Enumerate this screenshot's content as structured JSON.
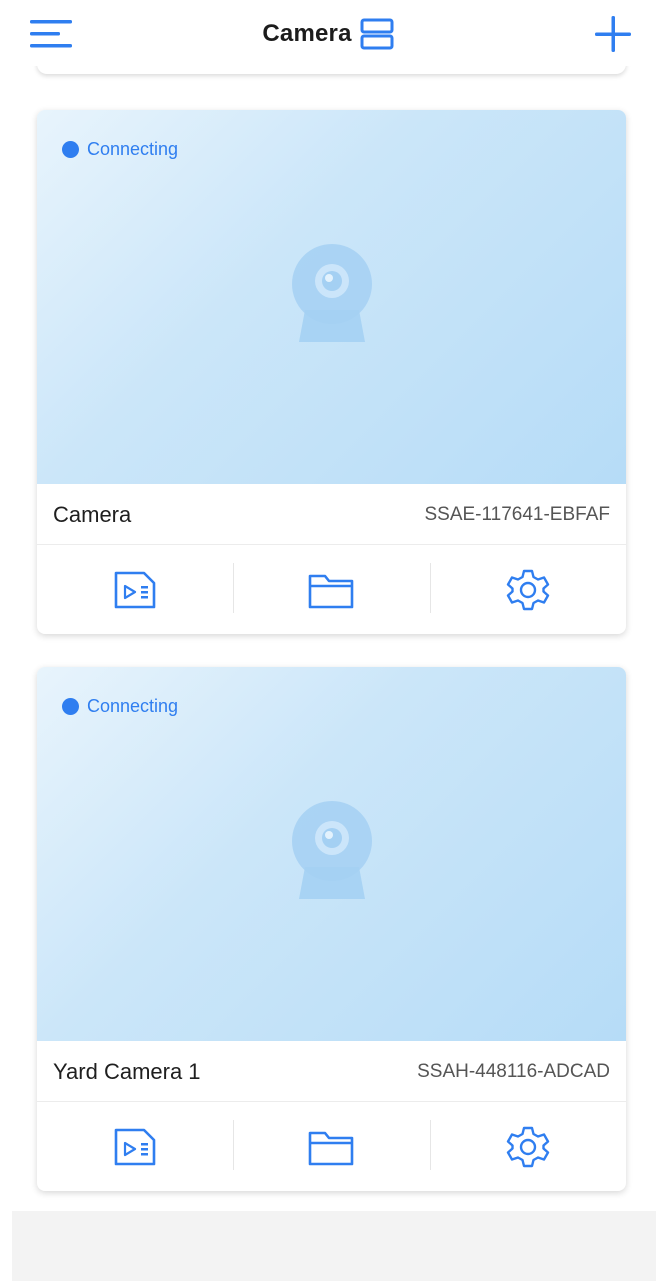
{
  "header": {
    "title": "Camera",
    "menu_icon": "menu-icon",
    "layout_icon": "layout-list-icon",
    "add_icon": "add-icon"
  },
  "colors": {
    "accent": "#2f7ef0",
    "preview_bg_light": "#e8f4fc",
    "preview_bg_dark": "#b6dcf7"
  },
  "cameras": [
    {
      "status": "Connecting",
      "name": "Camera",
      "id": "SSAE-117641-EBFAF",
      "actions": [
        "playback-icon",
        "folder-icon",
        "settings-icon"
      ]
    },
    {
      "status": "Connecting",
      "name": "Yard Camera 1",
      "id": "SSAH-448116-ADCAD",
      "actions": [
        "playback-icon",
        "folder-icon",
        "settings-icon"
      ]
    }
  ]
}
